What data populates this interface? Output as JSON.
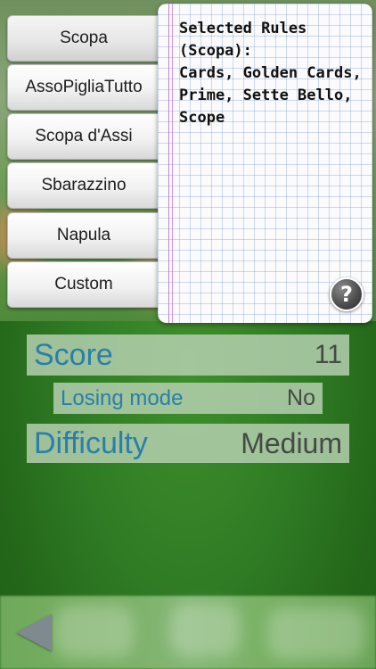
{
  "rules_menu": {
    "items": [
      {
        "label": "Scopa",
        "selected": true
      },
      {
        "label": "AssoPigliaTutto",
        "selected": false
      },
      {
        "label": "Scopa d'Assi",
        "selected": false
      },
      {
        "label": "Sbarazzino",
        "selected": false
      },
      {
        "label": "Napula",
        "selected": false
      },
      {
        "label": "Custom",
        "selected": false
      }
    ]
  },
  "notepad": {
    "text": "Selected Rules\n(Scopa):\n Cards, Golden Cards,\nPrime, Sette Bello,\nScope"
  },
  "help": {
    "symbol": "?"
  },
  "settings": {
    "score": {
      "label": "Score",
      "value": "11"
    },
    "losing_mode": {
      "label": "Losing mode",
      "value": "No"
    },
    "difficulty": {
      "label": "Difficulty",
      "value": "Medium"
    }
  },
  "colors": {
    "label_blue": "#2a7fa8",
    "table_green": "#2f7a24"
  }
}
